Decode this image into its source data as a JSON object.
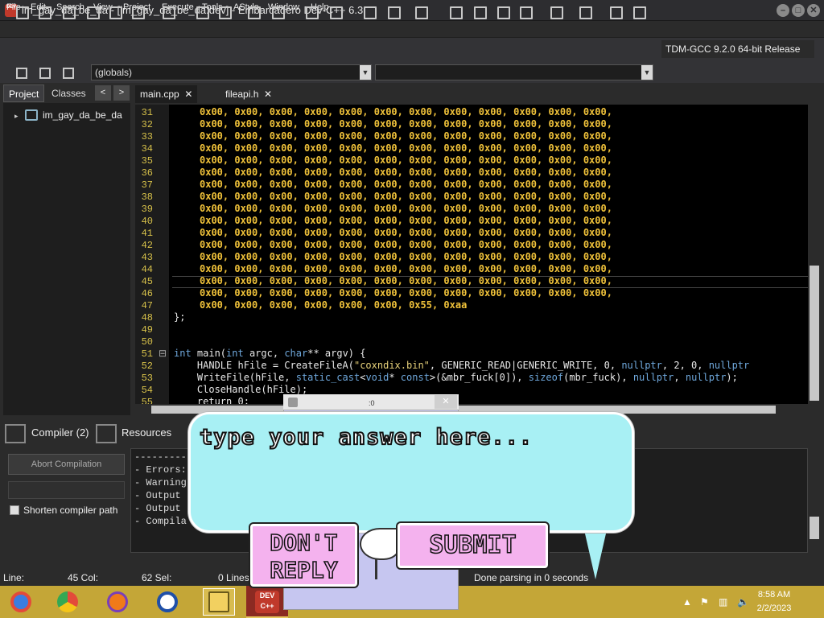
{
  "window": {
    "title": "im_gay_da_be_da - [im_gay_da_be_da.dev] - Embarcadero Dev-C++ 6.3",
    "app_icon": "DEV"
  },
  "menu": [
    "File",
    "Edit",
    "Search",
    "View",
    "Project",
    "Execute",
    "Tools",
    "AStyle",
    "Window",
    "Help"
  ],
  "toolbar": {
    "compiler": "TDM-GCC 9.2.0 64-bit Release"
  },
  "combos": {
    "scope": "(globals)",
    "symbol": ""
  },
  "left_panel": {
    "tabs": [
      "Project",
      "Classes"
    ],
    "nav_prev": "<",
    "nav_next": ">",
    "tree_root": "im_gay_da_be_da"
  },
  "editor": {
    "tabs": [
      {
        "label": "main.cpp",
        "close": "✕"
      },
      {
        "label": "fileapi.h",
        "close": "✕"
      }
    ],
    "hex_row": "0x00, 0x00, 0x00, 0x00, 0x00, 0x00, 0x00, 0x00, 0x00, 0x00, 0x00, 0x00,",
    "line47": "0x00, 0x00, 0x00, 0x00, 0x00, 0x00, 0x55, 0xaa",
    "line48": "};",
    "lines": [
      "31",
      "32",
      "33",
      "34",
      "35",
      "36",
      "37",
      "38",
      "39",
      "40",
      "41",
      "42",
      "43",
      "44",
      "45",
      "46",
      "47",
      "48",
      "49",
      "50",
      "51",
      "52",
      "53",
      "54",
      "55"
    ],
    "fold": "⊟",
    "line51": {
      "kw1": "int",
      "fn": " main(",
      "kw2": "int",
      "a": " argc, ",
      "kw3": "char",
      "b": "** argv) {"
    },
    "line52": {
      "a": "    HANDLE hFile = CreateFileA(",
      "s": "\"coxndix.bin\"",
      "b": ", GENERIC_READ|GENERIC_WRITE, 0, ",
      "k": "nullptr",
      "c": ", 2, 0, ",
      "k2": "nullptr"
    },
    "line53": {
      "a": "    WriteFile(hFile, ",
      "k": "static_cast",
      "b": "<",
      "k2": "void",
      "c": "* ",
      "k3": "const",
      "d": ">(&mbr_fuck[0]), ",
      "k4": "sizeof",
      "e": "(mbr_fuck), ",
      "k5": "nullptr",
      "f": ", ",
      "k6": "nullptr",
      "g": ");"
    },
    "line54": "    CloseHandle(hFile);",
    "line55": "    return 0;"
  },
  "bottom": {
    "tabs": [
      "Compiler (2)",
      "Resources"
    ],
    "abort": "Abort Compilation",
    "shorten": "Shorten compiler path",
    "log": [
      "---------",
      "- Errors:",
      "- Warning",
      "- Output",
      "- Output",
      "- Compila"
    ]
  },
  "status": {
    "line": "Line:",
    "col": "45 Col:",
    "sel": "62 Sel:",
    "lines": "0 Lines:",
    "parsing": "Done parsing in 0 seconds"
  },
  "popup": {
    "title": ":0",
    "close": "✕",
    "answer_placeholder": "type your answer here...",
    "dont_reply": "DON'T REPLY",
    "submit": "SUBMIT"
  },
  "taskbar": {
    "time": "8:58 AM",
    "date": "2/2/2023",
    "devcpp_label": "DEV C++"
  }
}
